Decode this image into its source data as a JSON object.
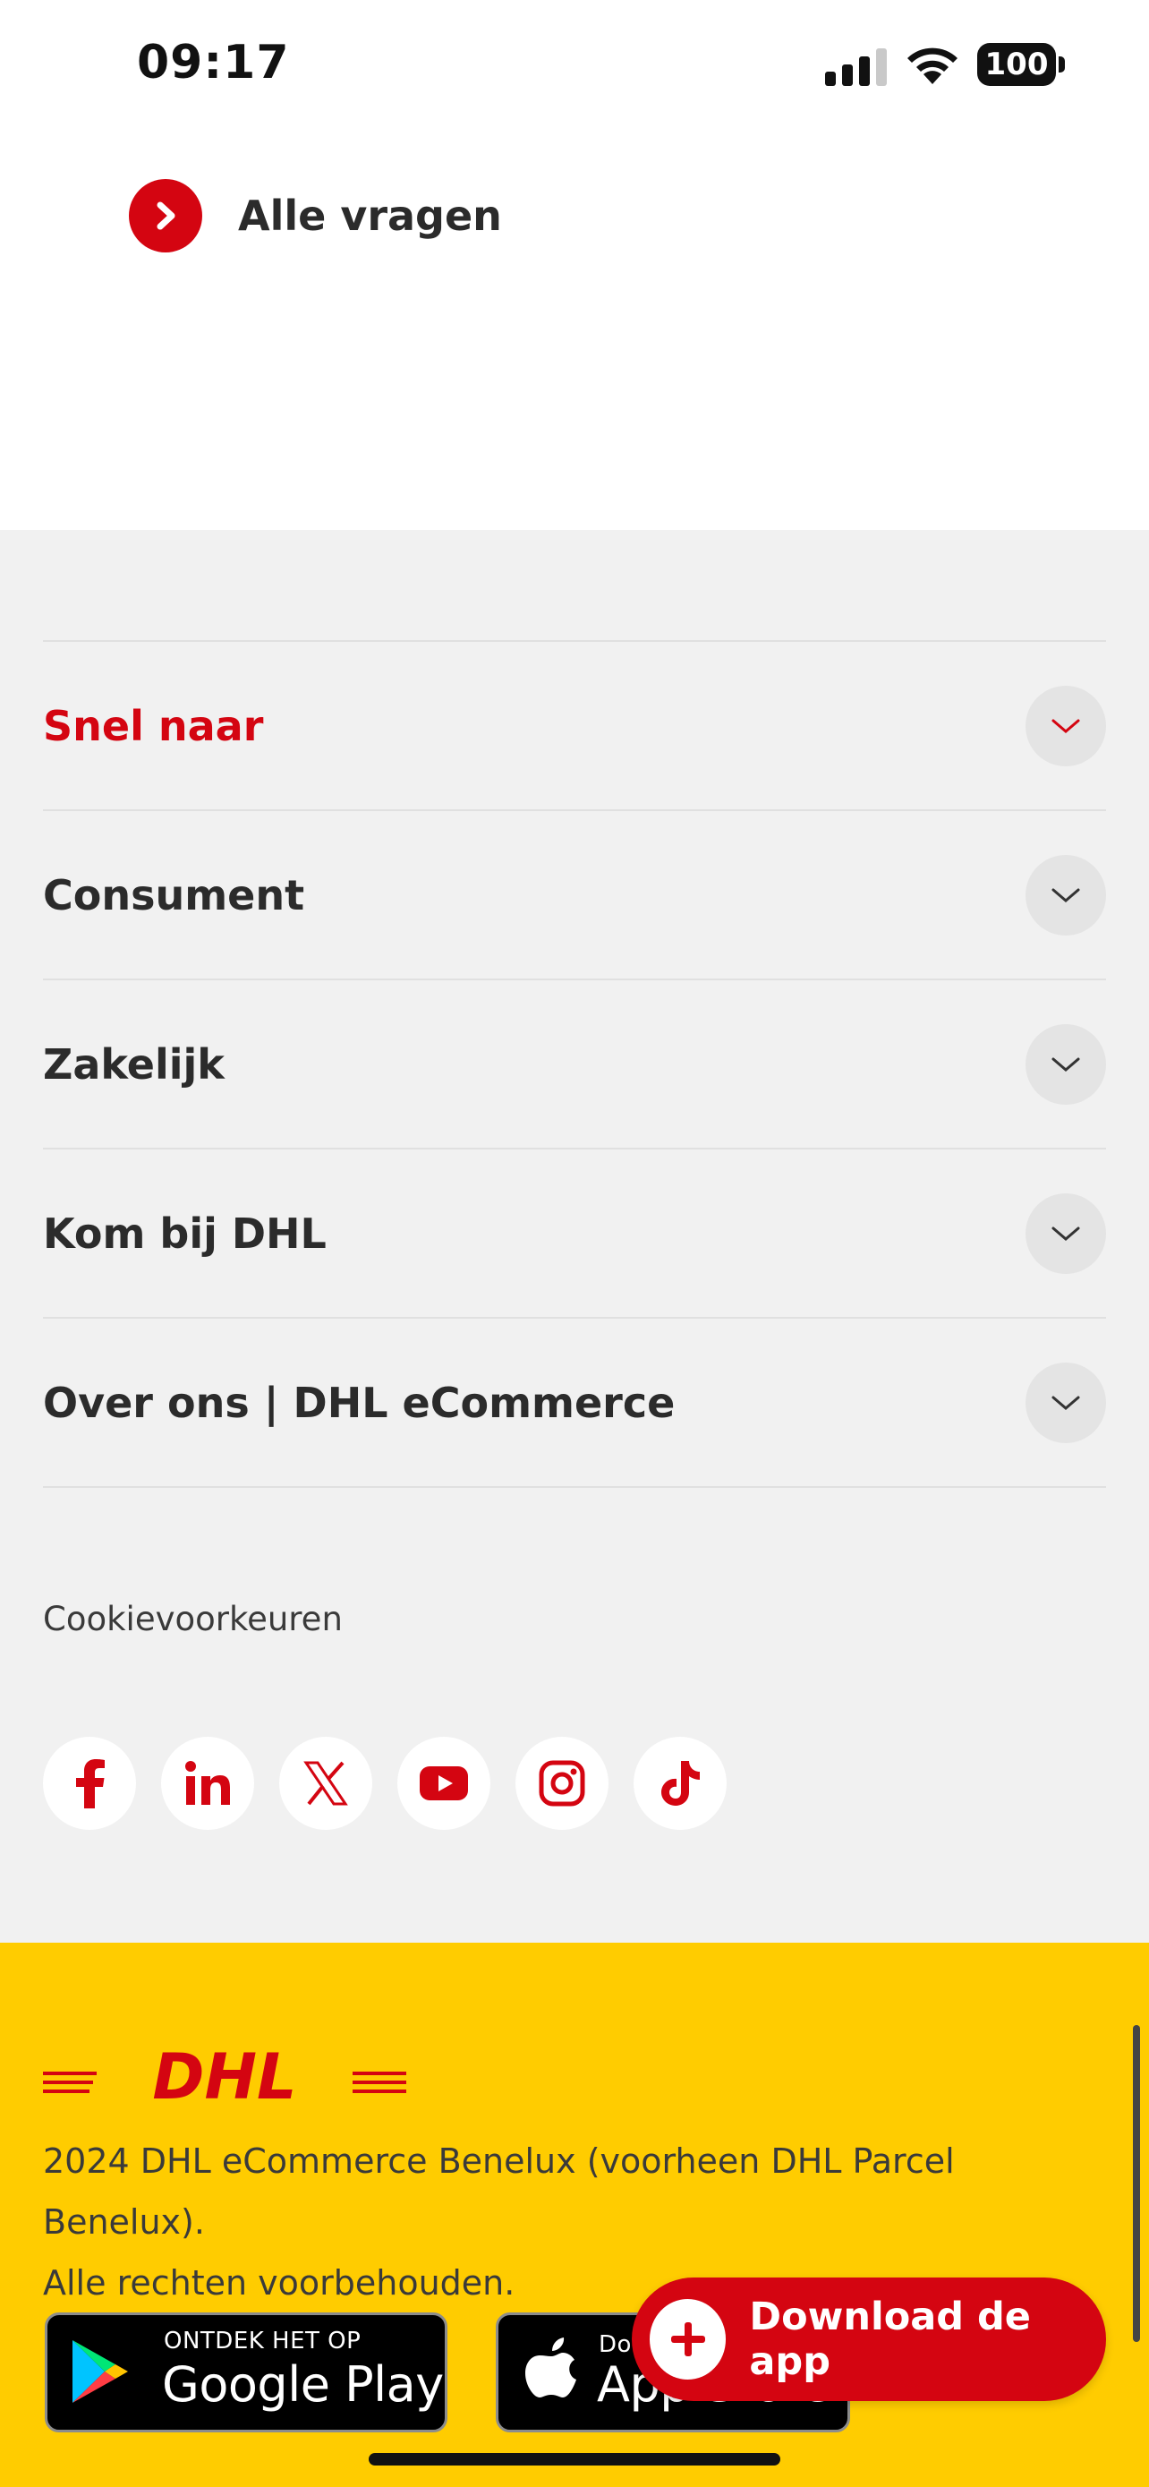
{
  "status_bar": {
    "time": "09:17",
    "battery": "100"
  },
  "all_questions": {
    "label": "Alle vragen"
  },
  "footer_nav": {
    "items": [
      {
        "label": "Snel naar",
        "active": true
      },
      {
        "label": "Consument",
        "active": false
      },
      {
        "label": "Zakelijk",
        "active": false
      },
      {
        "label": "Kom bij DHL",
        "active": false
      },
      {
        "label": "Over ons | DHL eCommerce",
        "active": false
      }
    ]
  },
  "cookie_preferences": "Cookievoorkeuren",
  "social": {
    "icons": [
      "facebook-icon",
      "linkedin-icon",
      "x-icon",
      "youtube-icon",
      "instagram-icon",
      "tiktok-icon"
    ]
  },
  "brand": {
    "logo": "DHL",
    "copyright_line1": "2024 DHL eCommerce Benelux (voorheen DHL Parcel Benelux).",
    "copyright_line2": "Alle rechten voorbehouden."
  },
  "store_badges": {
    "google_small": "ONTDEK HET OP",
    "google_big": "Google Play",
    "apple_small": "Download in de",
    "apple_big": "App Store"
  },
  "download_button": {
    "label": "Download de app"
  },
  "colors": {
    "dhl_red": "#d40511",
    "dhl_yellow": "#ffcc00",
    "footer_gray": "#f1f1f1"
  }
}
